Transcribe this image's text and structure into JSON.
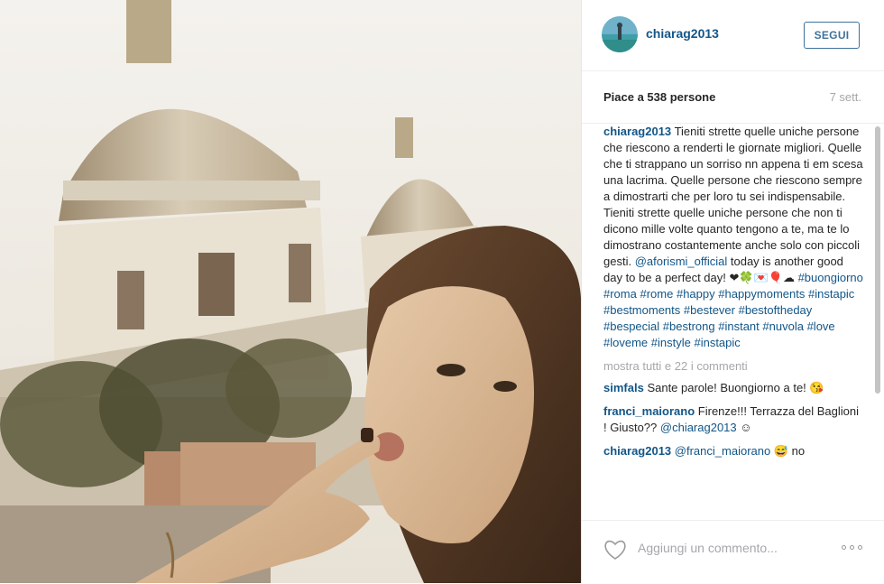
{
  "post": {
    "username": "chiarag2013",
    "follow_label": "SEGUI",
    "likes": "Piace a 538 persone",
    "time_ago": "7 sett."
  },
  "caption": {
    "user": "chiarag2013",
    "text": "Tieniti strette quelle uniche persone che riescono a renderti le giornate migliori. Quelle che ti strappano un sorriso nn appena ti em scesa una lacrima. Quelle persone che riescono sempre a dimostrarti che per loro tu sei indispensabile. Tieniti strette quelle uniche persone che non ti dicono mille volte quanto tengono a te, ma te lo dimostrano costantemente anche solo con piccoli gesti.",
    "mention": "@aforismi_official",
    "text2": "today is another good day to be a perfect day!",
    "emojis": "❤🍀💌🎈☁",
    "hashtags": [
      "#buongiorno",
      "#roma",
      "#rome",
      "#happy",
      "#happymoments",
      "#instapic",
      "#bestmoments",
      "#bestever",
      "#bestoftheday",
      "#bespecial",
      "#bestrong",
      "#instant",
      "#nuvola",
      "#love",
      "#loveme",
      "#instyle",
      "#instapic"
    ]
  },
  "show_all_comments": "mostra tutti e 22 i commenti",
  "comments": [
    {
      "user": "simfals",
      "text": "Sante parole! Buongiorno a te!",
      "emoji": "😘"
    },
    {
      "user": "franci_maiorano",
      "text": "Firenze!!! Terrazza del Baglioni ! Giusto??",
      "mention": "@chiarag2013",
      "emoji": "☺"
    },
    {
      "user": "chiarag2013",
      "mention": "@franci_maiorano",
      "emoji": "😅",
      "text": "no"
    }
  ],
  "footer": {
    "comment_placeholder": "Aggiungi un commento...",
    "heart_icon": "heart-outline-icon",
    "more_icon": "more-options-icon"
  },
  "colors": {
    "link": "#125688",
    "follow_border": "#3f729b",
    "muted": "#a5a7aa"
  }
}
